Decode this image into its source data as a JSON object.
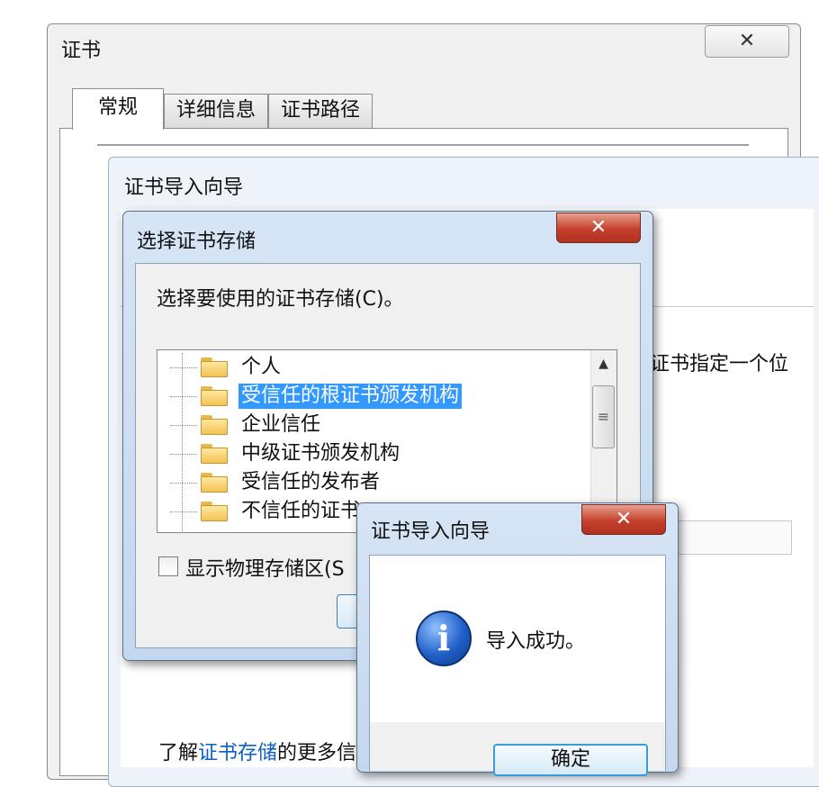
{
  "certificate_window": {
    "title": "证书",
    "close_glyph": "✕",
    "tabs": [
      {
        "label": "常规"
      },
      {
        "label": "详细信息"
      },
      {
        "label": "证书路径"
      }
    ]
  },
  "import_wizard": {
    "title": "证书导入向导",
    "body_text_fragment": "证书指定一个位",
    "learn_more_prefix": "了解",
    "learn_more_link": "证书存储",
    "learn_more_suffix": "的更多信"
  },
  "select_store_dialog": {
    "title": "选择证书存储",
    "close_glyph": "✕",
    "prompt": "选择要使用的证书存储(C)。",
    "stores": [
      {
        "label": "个人",
        "selected": false
      },
      {
        "label": "受信任的根证书颁发机构",
        "selected": true
      },
      {
        "label": "企业信任",
        "selected": false
      },
      {
        "label": "中级证书颁发机构",
        "selected": false
      },
      {
        "label": "受信任的发布者",
        "selected": false
      },
      {
        "label": "不信任的证书",
        "selected": false
      }
    ],
    "scroll_up_glyph": "▲",
    "scroll_thumb_glyph": "≡",
    "show_physical_label": "显示物理存储区(S"
  },
  "success_dialog": {
    "title": "证书导入向导",
    "close_glyph": "✕",
    "icon_glyph": "i",
    "message": "导入成功。",
    "ok_label": "确定"
  },
  "colors": {
    "selection": "#3399ff",
    "link": "#0a5fc4",
    "close_button": "#c4402c"
  }
}
